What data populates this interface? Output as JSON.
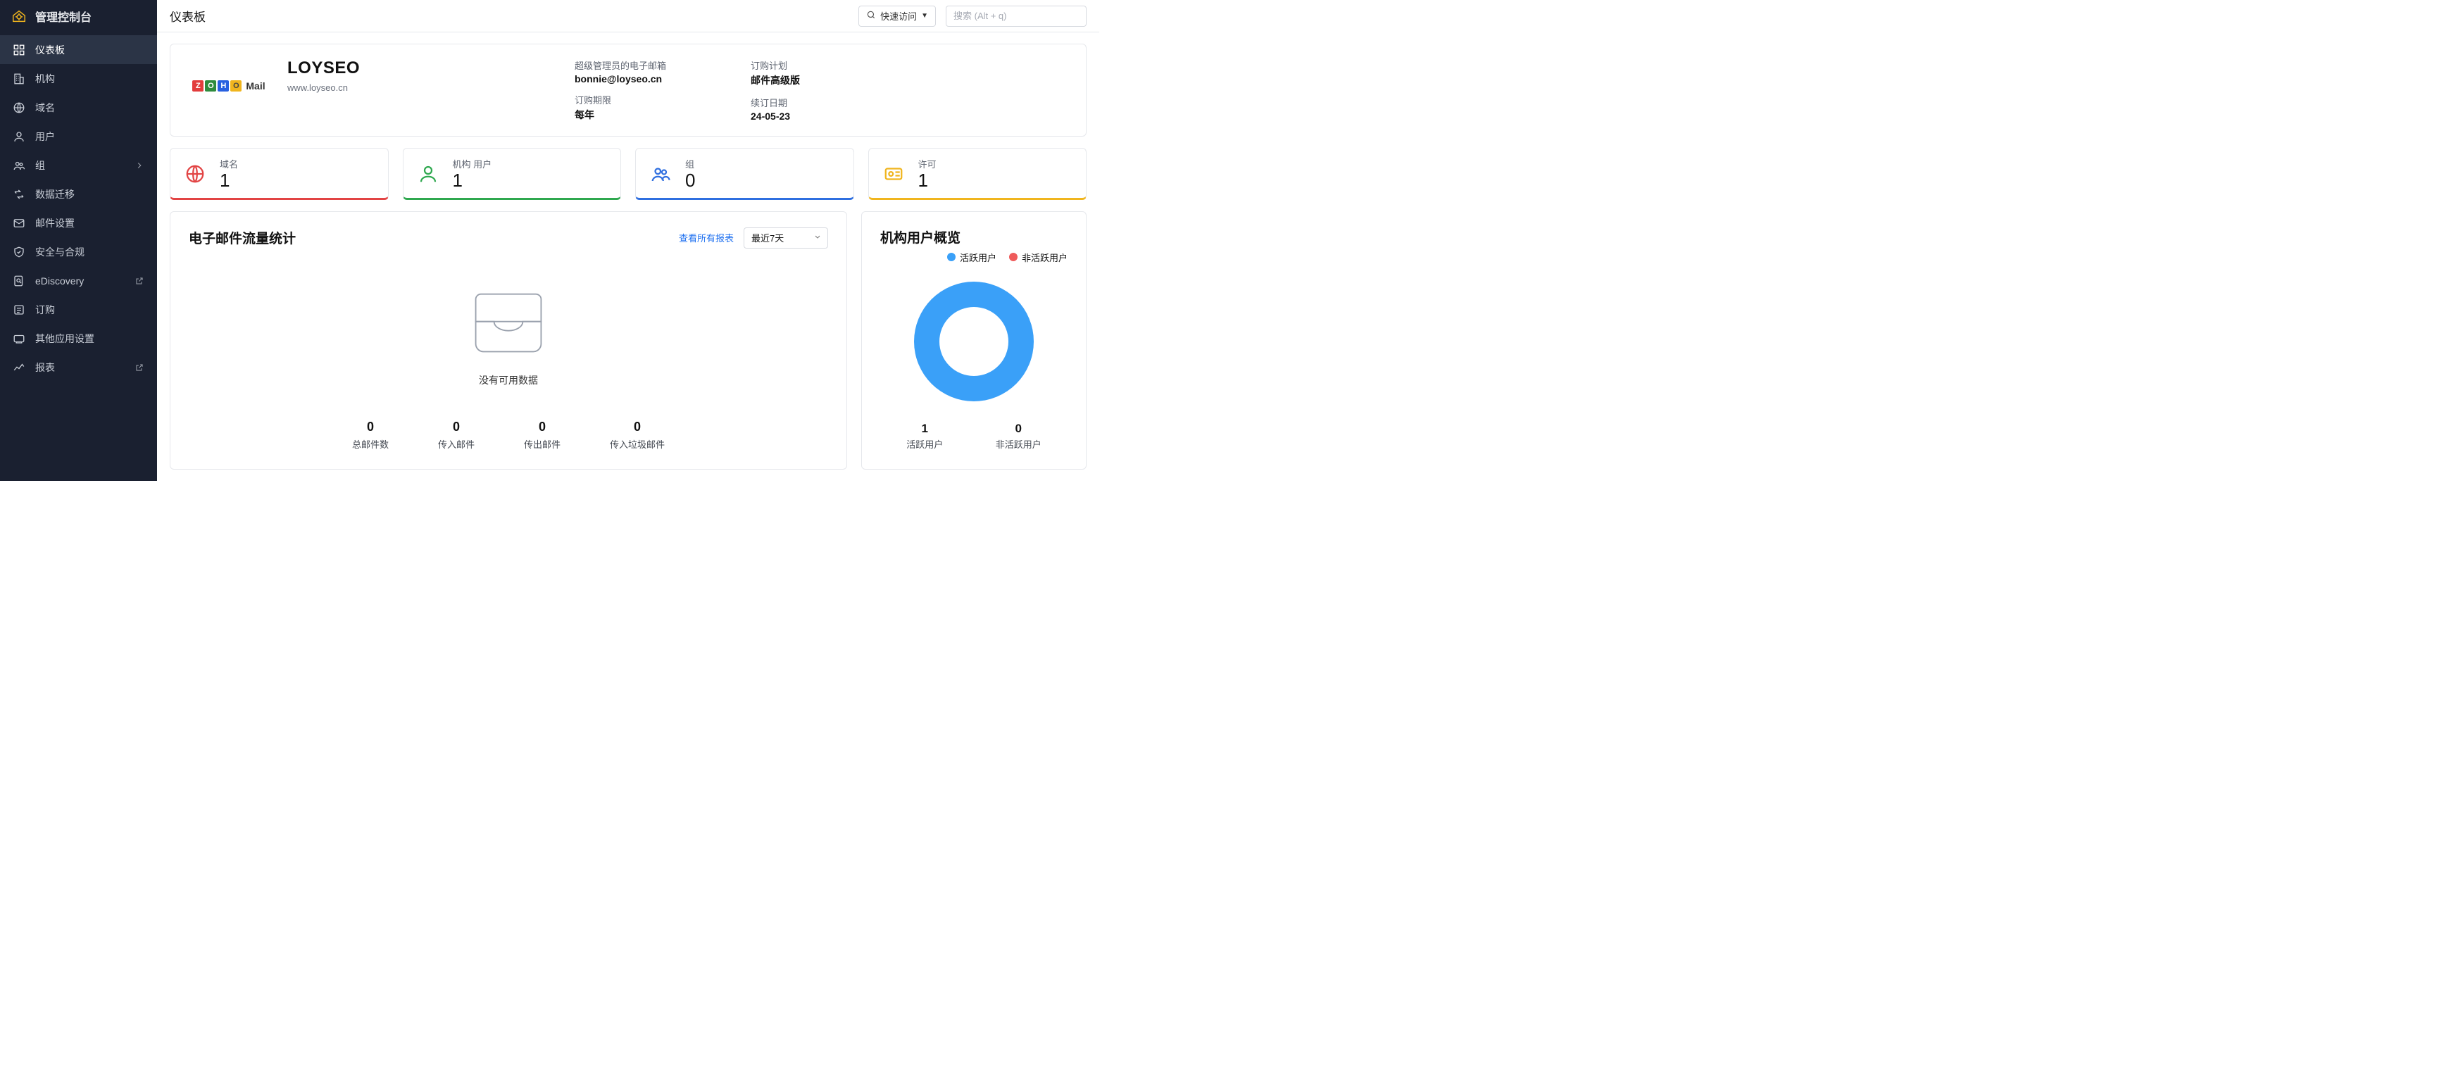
{
  "app_title": "管理控制台",
  "page_title": "仪表板",
  "topbar": {
    "quick_access": "快速访问",
    "search_placeholder": "搜索 (Alt + q)"
  },
  "sidebar": {
    "items": [
      {
        "label": "仪表板"
      },
      {
        "label": "机构"
      },
      {
        "label": "域名"
      },
      {
        "label": "用户"
      },
      {
        "label": "组"
      },
      {
        "label": "数据迁移"
      },
      {
        "label": "邮件设置"
      },
      {
        "label": "安全与合规"
      },
      {
        "label": "eDiscovery"
      },
      {
        "label": "订购"
      },
      {
        "label": "其他应用设置"
      },
      {
        "label": "报表"
      }
    ]
  },
  "org": {
    "name": "LOYSEO",
    "domain": "www.loyseo.cn",
    "logo_brand": "Mail",
    "admin_email_label": "超级管理员的电子邮箱",
    "admin_email": "bonnie@loyseo.cn",
    "sub_period_label": "订购期限",
    "sub_period": "每年",
    "plan_label": "订购计划",
    "plan": "邮件高级版",
    "renewal_label": "续订日期",
    "renewal": "24-05-23"
  },
  "stats": {
    "domain": {
      "label": "域名",
      "value": "1"
    },
    "users": {
      "label": "机构 用户",
      "value": "1"
    },
    "groups": {
      "label": "组",
      "value": "0"
    },
    "licenses": {
      "label": "许可",
      "value": "1"
    }
  },
  "traffic": {
    "title": "电子邮件流量统计",
    "view_all": "查看所有报表",
    "range": "最近7天",
    "empty": "没有可用数据",
    "cols": [
      {
        "label": "总邮件数",
        "value": "0"
      },
      {
        "label": "传入邮件",
        "value": "0"
      },
      {
        "label": "传出邮件",
        "value": "0"
      },
      {
        "label": "传入垃圾邮件",
        "value": "0"
      }
    ]
  },
  "user_overview": {
    "title": "机构用户概览",
    "legend_active": "活跃用户",
    "legend_inactive": "非活跃用户",
    "active": {
      "label": "活跃用户",
      "value": "1"
    },
    "inactive": {
      "label": "非活跃用户",
      "value": "0"
    }
  },
  "chart_data": {
    "type": "pie",
    "title": "机构用户概览",
    "series": [
      {
        "name": "活跃用户",
        "value": 1
      },
      {
        "name": "非活跃用户",
        "value": 0
      }
    ]
  }
}
